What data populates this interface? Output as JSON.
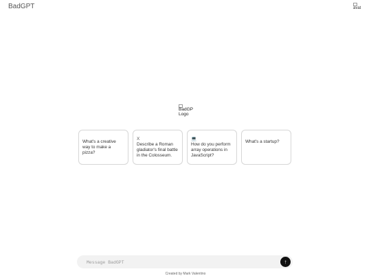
{
  "header": {
    "brand": "BadGPT",
    "avatar_alt": "avat"
  },
  "logo": {
    "alt_line1": "BadGP",
    "alt_line2": "Logo"
  },
  "suggestions": [
    {
      "icon": "",
      "text": "What's a creative way to make a pizza?"
    },
    {
      "icon": "X",
      "text": "Describe a Roman gladiator's final battle in the Colosseum."
    },
    {
      "icon": "💻",
      "text": "How do you perform array operations in JavaScript?"
    },
    {
      "icon": "",
      "text": "What's a startup?"
    }
  ],
  "composer": {
    "placeholder": "Message BadGPT",
    "send_icon": "↑"
  },
  "footer": {
    "credit": "Created by Mark Valentino"
  }
}
